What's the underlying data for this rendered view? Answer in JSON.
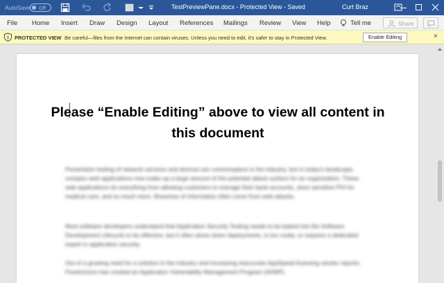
{
  "titlebar": {
    "autosave_label": "AutoSave",
    "autosave_state": "Off",
    "document_title": "TestPreviewPane.docx  -  Protected View  -  Saved",
    "user_name": "Curt Braz"
  },
  "menu": {
    "items": [
      "File",
      "Home",
      "Insert",
      "Draw",
      "Design",
      "Layout",
      "References",
      "Mailings",
      "Review",
      "View",
      "Help"
    ],
    "tell_me": "Tell me",
    "share": "Share"
  },
  "protected_view": {
    "title": "PROTECTED VIEW",
    "message": "Be careful—files from the Internet can contain viruses. Unless you need to edit, it's safer to stay in Protected View.",
    "enable_button": "Enable Editing",
    "close": "×"
  },
  "document": {
    "heading": "Please “Enable Editing” above to view all content in this document",
    "paragraphs": [
      "Penetration testing of network services and devices are commonplace in the industry, but in today's landscape, complex web applications now make up a large amount of the potential attack surface for an organization. These web applications do everything from allowing customers to manage their bank accounts, store sensitive PHI for medical care, and so much more. Breaches of information often come from web attacks.",
      "Most software developers understand that Application Security Testing needs to be baked into the Software Development Lifecycle to be effective, but it often slows down deployments, is too costly, or requires a dedicated expert in application security.",
      "Out of a growing need for a solution in the industry and increasing inaccurate AppSpeed licensing vendor reports, Fireshorizon has created an Application Vulnerability Management Program (AVMP)."
    ]
  }
}
